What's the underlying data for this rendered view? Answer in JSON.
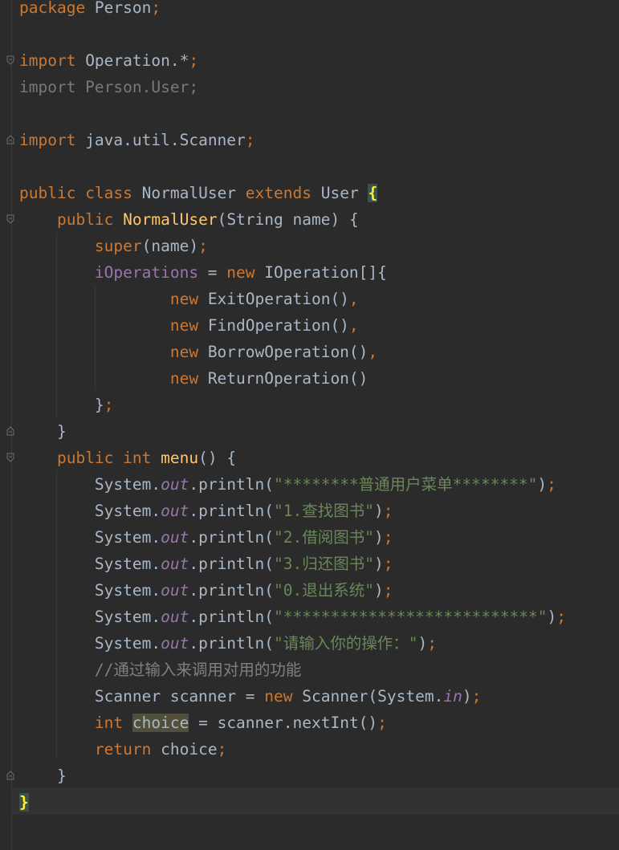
{
  "editor": {
    "language": "java",
    "theme_colors": {
      "background": "#2b2b2b",
      "keyword": "#cc7832",
      "string": "#6a8759",
      "comment": "#808080",
      "field": "#9876aa",
      "method_declaration": "#ffc66d",
      "default_text": "#a9b7c6"
    },
    "code": {
      "package_kw": "package",
      "package_name": " Person",
      "import_kw": "import",
      "import_1": " Operation.*",
      "import_2": "import Person.User;",
      "import_3": " java.util.Scanner",
      "public_kw": "public",
      "class_kw": " class",
      "class_name": " NormalUser ",
      "extends_kw": "extends",
      "super_class": " User ",
      "open_brace": "{",
      "close_brace": "}",
      "ctor_name": "NormalUser",
      "ctor_params": "(String name) {",
      "super_kw": "super",
      "super_args": "(name)",
      "field_name": "iOperations",
      "assign": " = ",
      "new_kw": "new",
      "array_type": " IOperation[]{",
      "op_1": " ExitOperation()",
      "op_2": " FindOperation()",
      "op_3": " BorrowOperation()",
      "op_4": " ReturnOperation()",
      "array_close": "}",
      "semicolon": ";",
      "comma": ",",
      "method_close": "}",
      "int_kw": "int",
      "menu_name": " menu",
      "menu_params": "() {",
      "system": "System.",
      "out": "out",
      "println_open": ".println(",
      "println_close": ")",
      "str_1": "\"********普通用户菜单********\"",
      "str_2": "\"1.查找图书\"",
      "str_3": "\"2.借阅图书\"",
      "str_4": "\"3.归还图书\"",
      "str_5": "\"0.退出系统\"",
      "str_6": "\"***************************\"",
      "str_7": "\"请输入你的操作：\"",
      "comment": "//通过输入来调用对用的功能",
      "scanner_decl": "Scanner scanner = ",
      "scanner_ctor": " Scanner(System.",
      "in": "in",
      "choice": "choice",
      "next_int": " = scanner.nextInt()",
      "return_kw": "return",
      "return_val": " choice"
    }
  }
}
